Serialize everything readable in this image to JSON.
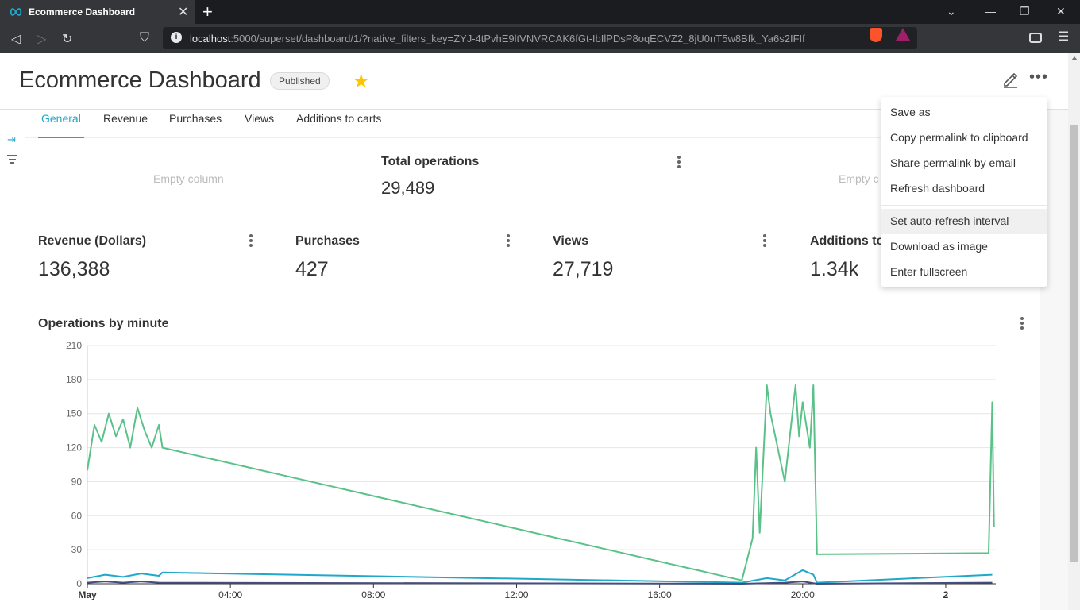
{
  "browser": {
    "tab_title": "Ecommerce Dashboard",
    "new_tab": "+",
    "url_host": "localhost",
    "url_rest": ":5000/superset/dashboard/1/?native_filters_key=ZYJ-4tPvhE9ltVNVRCAK6fGt-IbIlPDsP8oqECVZ2_8jU0nT5w8Bfk_Ya6s2IFIf"
  },
  "dashboard": {
    "title": "Ecommerce Dashboard",
    "status": "Published",
    "tabs": [
      "General",
      "Revenue",
      "Purchases",
      "Views",
      "Additions to carts"
    ],
    "empty_column": "Empty column",
    "empty_column_clipped": "Empty c"
  },
  "kpis": {
    "total": {
      "title": "Total operations",
      "value": "29,489"
    },
    "revenue": {
      "title": "Revenue (Dollars)",
      "value": "136,388"
    },
    "purchases": {
      "title": "Purchases",
      "value": "427"
    },
    "views": {
      "title": "Views",
      "value": "27,719"
    },
    "carts": {
      "title": "Additions to",
      "value": "1.34k"
    }
  },
  "menu": {
    "items": [
      "Save as",
      "Copy permalink to clipboard",
      "Share permalink by email",
      "Refresh dashboard",
      "Set auto-refresh interval",
      "Download as image",
      "Enter fullscreen"
    ]
  },
  "chart_data": {
    "type": "line",
    "title": "Operations by minute",
    "ylim": [
      0,
      210
    ],
    "yticks": [
      0,
      30,
      60,
      90,
      120,
      150,
      180,
      210
    ],
    "xtick_labels": [
      "May",
      "04:00",
      "08:00",
      "12:00",
      "16:00",
      "20:00",
      "2"
    ],
    "x_unit": "hours since May 1 00:00",
    "series": [
      {
        "name": "",
        "color": "#5ac189",
        "x": [
          0,
          0.2,
          0.4,
          0.6,
          0.8,
          1.0,
          1.2,
          1.4,
          1.6,
          1.8,
          2.0,
          2.1,
          18.3,
          18.6,
          18.7,
          18.8,
          19.0,
          19.1,
          19.5,
          19.8,
          19.9,
          20.0,
          20.2,
          20.3,
          20.4,
          25.2,
          25.3,
          25.35
        ],
        "y": [
          100,
          140,
          125,
          150,
          130,
          145,
          120,
          155,
          135,
          120,
          140,
          120,
          3,
          40,
          120,
          45,
          175,
          150,
          90,
          175,
          130,
          160,
          120,
          175,
          26,
          27,
          160,
          50
        ]
      },
      {
        "name": "",
        "color": "#1fa8c9",
        "x": [
          0,
          0.5,
          1.0,
          1.5,
          2.0,
          2.1,
          18.3,
          19.0,
          19.5,
          20.0,
          20.3,
          20.4,
          25.3
        ],
        "y": [
          5,
          8,
          6,
          9,
          7,
          10,
          1,
          5,
          3,
          12,
          8,
          1,
          8
        ]
      },
      {
        "name": "",
        "color": "#454e7c",
        "x": [
          0,
          0.5,
          1.0,
          1.5,
          2.0,
          18.3,
          19.5,
          20.0,
          20.4,
          25.3
        ],
        "y": [
          1,
          2,
          1,
          2,
          1,
          0,
          1,
          2,
          0,
          1
        ]
      }
    ]
  }
}
